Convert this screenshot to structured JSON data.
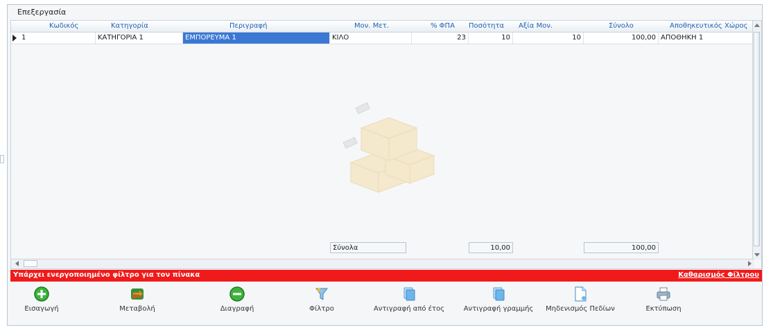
{
  "section": {
    "title": "Επεξεργασία"
  },
  "table": {
    "columns": [
      "Κωδικός",
      "Κατηγορία",
      "Περιγραφή",
      "Μον. Μετ.",
      "% ΦΠΑ",
      "Ποσότητα",
      "Αξία Μον.",
      "Σύνολο",
      "Αποθηκευτικός Χώρος"
    ],
    "rows": [
      {
        "code": "1",
        "category": "ΚΑΤΗΓΟΡΙΑ 1",
        "description": "ΕΜΠΟΡΕΥΜΑ 1",
        "unit": "ΚΙΛΟ",
        "vat": "23",
        "quantity": "10",
        "unit_value": "10",
        "total": "100,00",
        "storage": "ΑΠΟΘΗΚΗ 1"
      }
    ],
    "totals": {
      "label": "Σύνολα",
      "quantity": "10,00",
      "total": "100,00"
    }
  },
  "filter_bar": {
    "message": "Υπάρχει ενεργοποιημένο φίλτρο για τον πίνακα",
    "clear_label": "Καθαρισμός Φίλτρου",
    "color": "#f01a1a"
  },
  "toolbar": {
    "insert": "Εισαγωγή",
    "edit": "Μεταβολή",
    "delete": "Διαγραφή",
    "filter": "Φίλτρο",
    "copy_from_year": "Αντιγραφή από έτος",
    "copy_row": "Αντιγραφή γραμμής",
    "zero_fields": "Μηδενισμός Πεδίων",
    "print": "Εκτύπωση"
  },
  "icons": {
    "insert": "plus-circle-icon",
    "edit": "edit-arrows-icon",
    "delete": "minus-circle-icon",
    "filter": "filter-icon",
    "copy": "copy-document-icon",
    "zero_fields": "blank-document-icon",
    "print": "printer-icon"
  }
}
